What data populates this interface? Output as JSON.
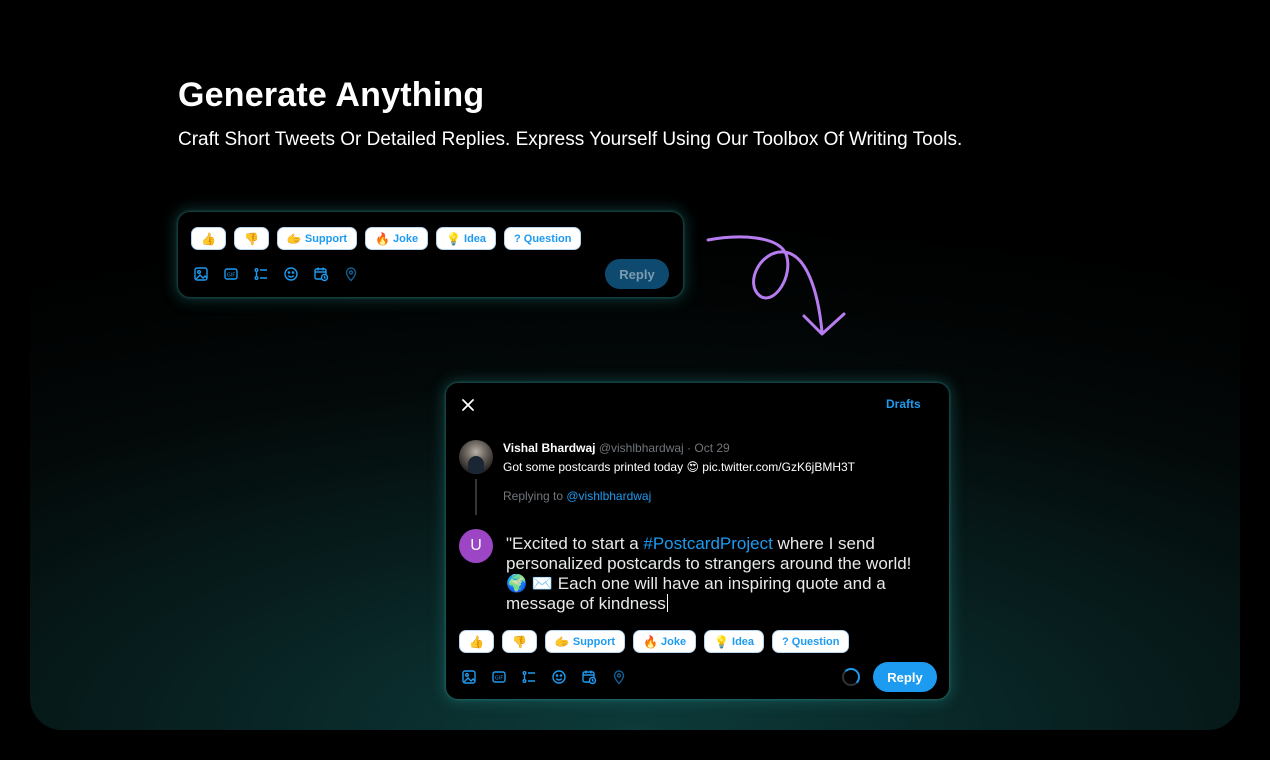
{
  "heading": "Generate Anything",
  "subheading": "Craft Short Tweets Or Detailed Replies. Express Yourself Using Our Toolbox Of Writing Tools.",
  "chips": [
    {
      "emoji": "👍",
      "label": ""
    },
    {
      "emoji": "👎",
      "label": ""
    },
    {
      "emoji": "🫱",
      "label": "Support"
    },
    {
      "emoji": "🔥",
      "label": "Joke"
    },
    {
      "emoji": "💡",
      "label": "Idea"
    },
    {
      "emoji": "?",
      "label": "Question"
    }
  ],
  "tool_icons": [
    "image-icon",
    "gif-icon",
    "poll-icon",
    "emoji-icon",
    "schedule-icon",
    "location-icon"
  ],
  "composer_small": {
    "reply_label": "Reply"
  },
  "composer_large": {
    "drafts_label": "Drafts",
    "tweet": {
      "author_name": "Vishal Bhardwaj",
      "author_meta": "@vishlbhardwaj · Oct 29",
      "text_before": "Got some postcards printed today ",
      "emoji": "😍",
      "text_after": " pic.twitter.com/GzK6jBMH3T"
    },
    "replying_prefix": "Replying to ",
    "replying_handle": "@vishlbhardwaj",
    "user_initial": "U",
    "draft": {
      "part1": "\"Excited to start a ",
      "hashtag": "#PostcardProject",
      "part2": " where I send personalized postcards to strangers around the world!  🌍  ✉️  Each one will have an inspiring quote and a message of kindness"
    },
    "reply_label": "Reply"
  },
  "colors": {
    "accent": "#1d9bf0",
    "arrow": "#b77cf0",
    "avatar_user": "#9c46c6"
  }
}
